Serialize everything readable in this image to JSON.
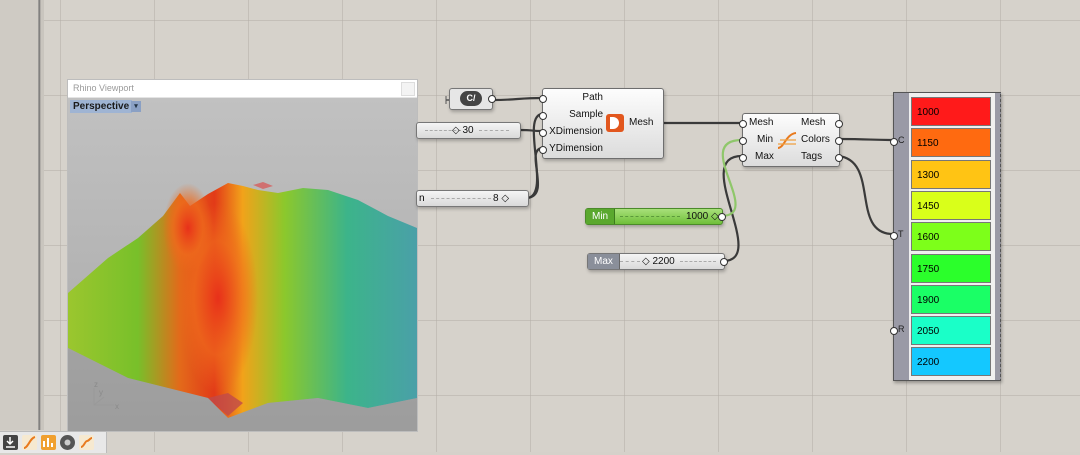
{
  "viewport": {
    "title": "Rhino Viewport",
    "view_label": "Perspective",
    "dropdown_glyph": "▾",
    "axis_z": "z",
    "axis_y": "y",
    "axis_x": "x"
  },
  "sliders": {
    "xdim_value": "30",
    "ydim_label_fragment": "n",
    "ydim_value": "8",
    "min_label": "Min",
    "min_value": "1000",
    "max_label": "Max",
    "max_value": "2200"
  },
  "curve_component": {
    "icon": "curve-icon",
    "glyph": "C/"
  },
  "mesh_component": {
    "inputs": [
      "Path",
      "Sample",
      "XDimension",
      "YDimension"
    ],
    "output": "Mesh",
    "icon": "mesh-sample-icon"
  },
  "color_component": {
    "inputs": [
      "Mesh",
      "Min",
      "Max"
    ],
    "outputs": [
      "Mesh",
      "Colors",
      "Tags"
    ],
    "icon": "gradient-curve-icon"
  },
  "gradient_list": {
    "port_c": "C",
    "port_t": "T",
    "port_r": "R",
    "items": [
      {
        "label": "1000",
        "color": "#ff1a1a"
      },
      {
        "label": "1150",
        "color": "#ff6a10"
      },
      {
        "label": "1300",
        "color": "#ffc414"
      },
      {
        "label": "1450",
        "color": "#d9ff1a"
      },
      {
        "label": "1600",
        "color": "#7dff1a"
      },
      {
        "label": "1750",
        "color": "#2bff2b"
      },
      {
        "label": "1900",
        "color": "#1aff66"
      },
      {
        "label": "2050",
        "color": "#1affc8"
      },
      {
        "label": "2200",
        "color": "#14c8ff"
      }
    ]
  },
  "wire_colors": {
    "default": "#3a3a3a",
    "min_wire": "#8fc76a"
  },
  "taskbar": {
    "icons": [
      "download-icon",
      "gradient-icon",
      "chart-icon",
      "gear-icon",
      "curve-icon"
    ]
  }
}
